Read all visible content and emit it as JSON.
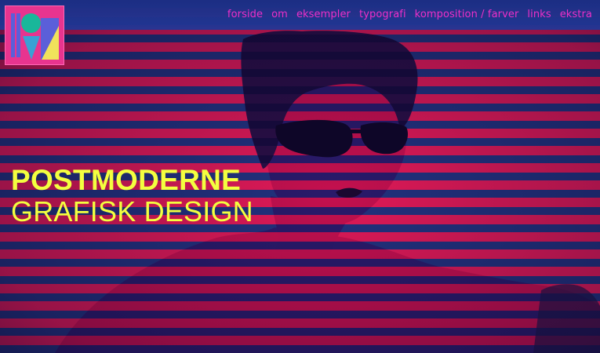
{
  "nav": {
    "items": [
      {
        "label": "forside"
      },
      {
        "label": "om"
      },
      {
        "label": "eksempler"
      },
      {
        "label": "typografi"
      },
      {
        "label": "komposition / farver"
      },
      {
        "label": "links"
      },
      {
        "label": "ekstra"
      }
    ]
  },
  "hero": {
    "title_line1": "POSTMODERNE",
    "title_line2": "GRAFISK DESIGN"
  },
  "colors": {
    "nav_link": "#ee2fc9",
    "headline": "#f3ff3f",
    "stripe_red": "#e21a57",
    "stripe_blue": "#22327e",
    "logo_bg": "#e8348f"
  }
}
